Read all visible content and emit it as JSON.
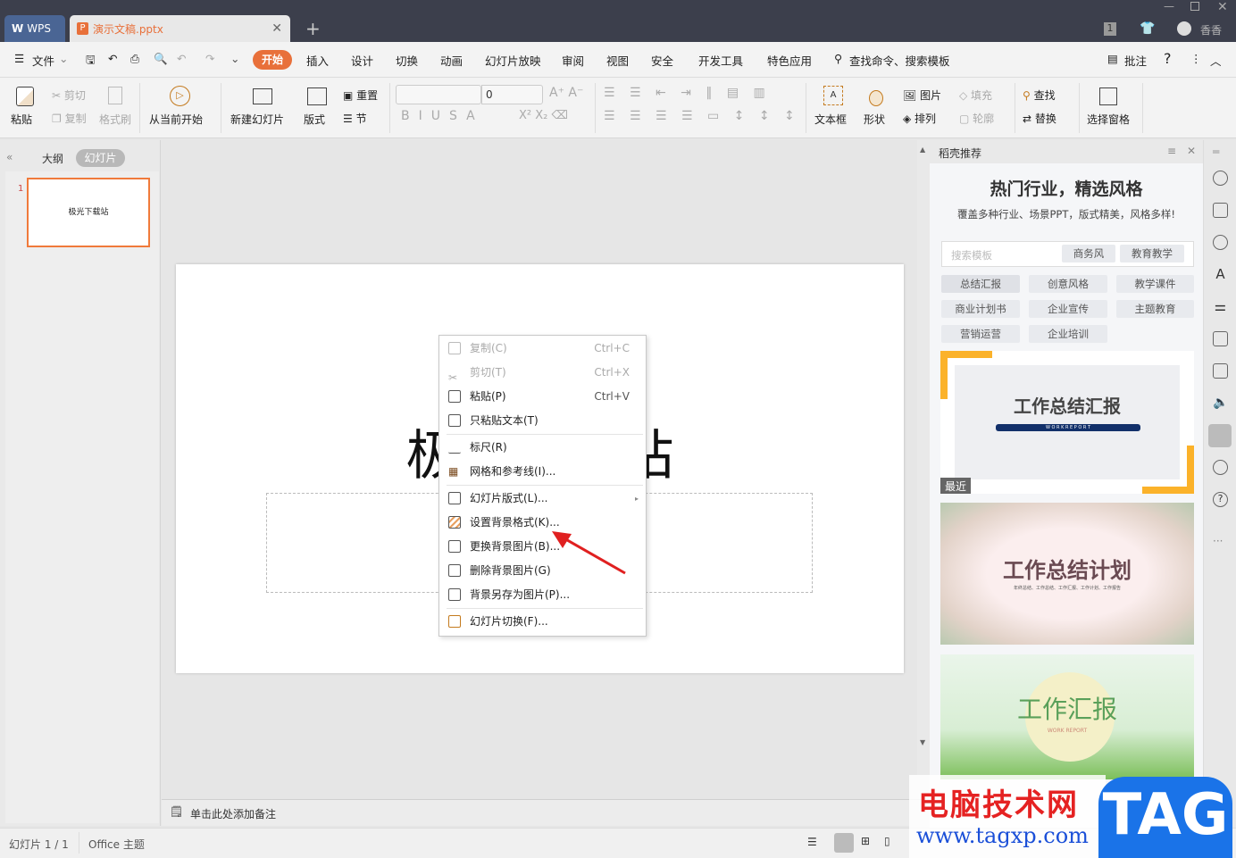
{
  "titlebar": {
    "app_tab": "WPS",
    "doc_tab": "演示文稿.pptx",
    "user": "香香",
    "badge": "1"
  },
  "menu": {
    "file": "文件",
    "tabs": [
      "开始",
      "插入",
      "设计",
      "切换",
      "动画",
      "幻灯片放映",
      "审阅",
      "视图",
      "安全",
      "开发工具",
      "特色应用"
    ],
    "search": "查找命令、搜索模板",
    "comment": "批注",
    "help": "?"
  },
  "ribbon": {
    "paste": "粘贴",
    "cut": "剪切",
    "copy": "复制",
    "format_painter": "格式刷",
    "from_current": "从当前开始",
    "new_slide": "新建幻灯片",
    "layout": "版式",
    "reset": "重置",
    "section": "节",
    "font_size": "0",
    "textbox": "文本框",
    "shape": "形状",
    "picture": "图片",
    "arrange": "排列",
    "fill": "填充",
    "outline": "轮廓",
    "find": "查找",
    "replace": "替换",
    "selection_pane": "选择窗格"
  },
  "left_panel": {
    "tabs": [
      "大纲",
      "幻灯片"
    ],
    "active_tab": "幻灯片",
    "slide_number": "1",
    "thumb_text": "极光下载站"
  },
  "slide": {
    "title": "极光下载站"
  },
  "notes": {
    "placeholder": "单击此处添加备注"
  },
  "context_menu": {
    "items": [
      {
        "label": "复制(C)",
        "shortcut": "Ctrl+C",
        "disabled": true,
        "icon": "copy-icon"
      },
      {
        "label": "剪切(T)",
        "shortcut": "Ctrl+X",
        "disabled": true,
        "icon": "cut-icon"
      },
      {
        "label": "粘贴(P)",
        "shortcut": "Ctrl+V",
        "disabled": false,
        "icon": "paste-icon"
      },
      {
        "label": "只粘贴文本(T)",
        "shortcut": "",
        "disabled": false,
        "icon": "paste-text-icon"
      },
      {
        "label": "标尺(R)",
        "shortcut": "",
        "disabled": false,
        "icon": "ruler-icon"
      },
      {
        "label": "网格和参考线(I)...",
        "shortcut": "",
        "disabled": false,
        "icon": "grid-icon"
      },
      {
        "label": "幻灯片版式(L)...",
        "shortcut": "",
        "disabled": false,
        "icon": "layout-icon",
        "submenu": true
      },
      {
        "label": "设置背景格式(K)...",
        "shortcut": "",
        "disabled": false,
        "icon": "background-format-icon"
      },
      {
        "label": "更换背景图片(B)...",
        "shortcut": "",
        "disabled": false,
        "icon": "change-background-icon"
      },
      {
        "label": "删除背景图片(G)",
        "shortcut": "",
        "disabled": false,
        "icon": "delete-background-icon"
      },
      {
        "label": "背景另存为图片(P)...",
        "shortcut": "",
        "disabled": false,
        "icon": "save-background-icon"
      },
      {
        "label": "幻灯片切换(F)...",
        "shortcut": "",
        "disabled": false,
        "icon": "transition-icon"
      }
    ]
  },
  "right_panel": {
    "header": "稻壳推荐",
    "headline": "热门行业，精选风格",
    "subline": "覆盖多种行业、场景PPT，版式精美，风格多样!",
    "search_placeholder": "搜索模板",
    "quick_tags": [
      "商务风",
      "教育教学"
    ],
    "categories": [
      "总结汇报",
      "创意风格",
      "教学课件",
      "商业计划书",
      "企业宣传",
      "主题教育",
      "营销运营",
      "企业培训"
    ],
    "templates": [
      {
        "title": "工作总结汇报",
        "subtitle": "W O R K   R E P O R T",
        "badge": "最近"
      },
      {
        "title": "工作总结计划",
        "subtitle": "年终总结、工作总结、工作汇报、工作计划、工作报告"
      },
      {
        "title": "工作汇报",
        "subtitle": "WORK REPORT"
      }
    ]
  },
  "statusbar": {
    "slide_count": "幻灯片 1 / 1",
    "theme": "Office 主题"
  },
  "watermark": {
    "text1": "电脑技术网",
    "text2": "www.tagxp.com",
    "logo": "TAG"
  },
  "colors": {
    "accent": "#e8703a",
    "titlebar": "#3c3f4c",
    "wps_blue": "#4a6594"
  }
}
